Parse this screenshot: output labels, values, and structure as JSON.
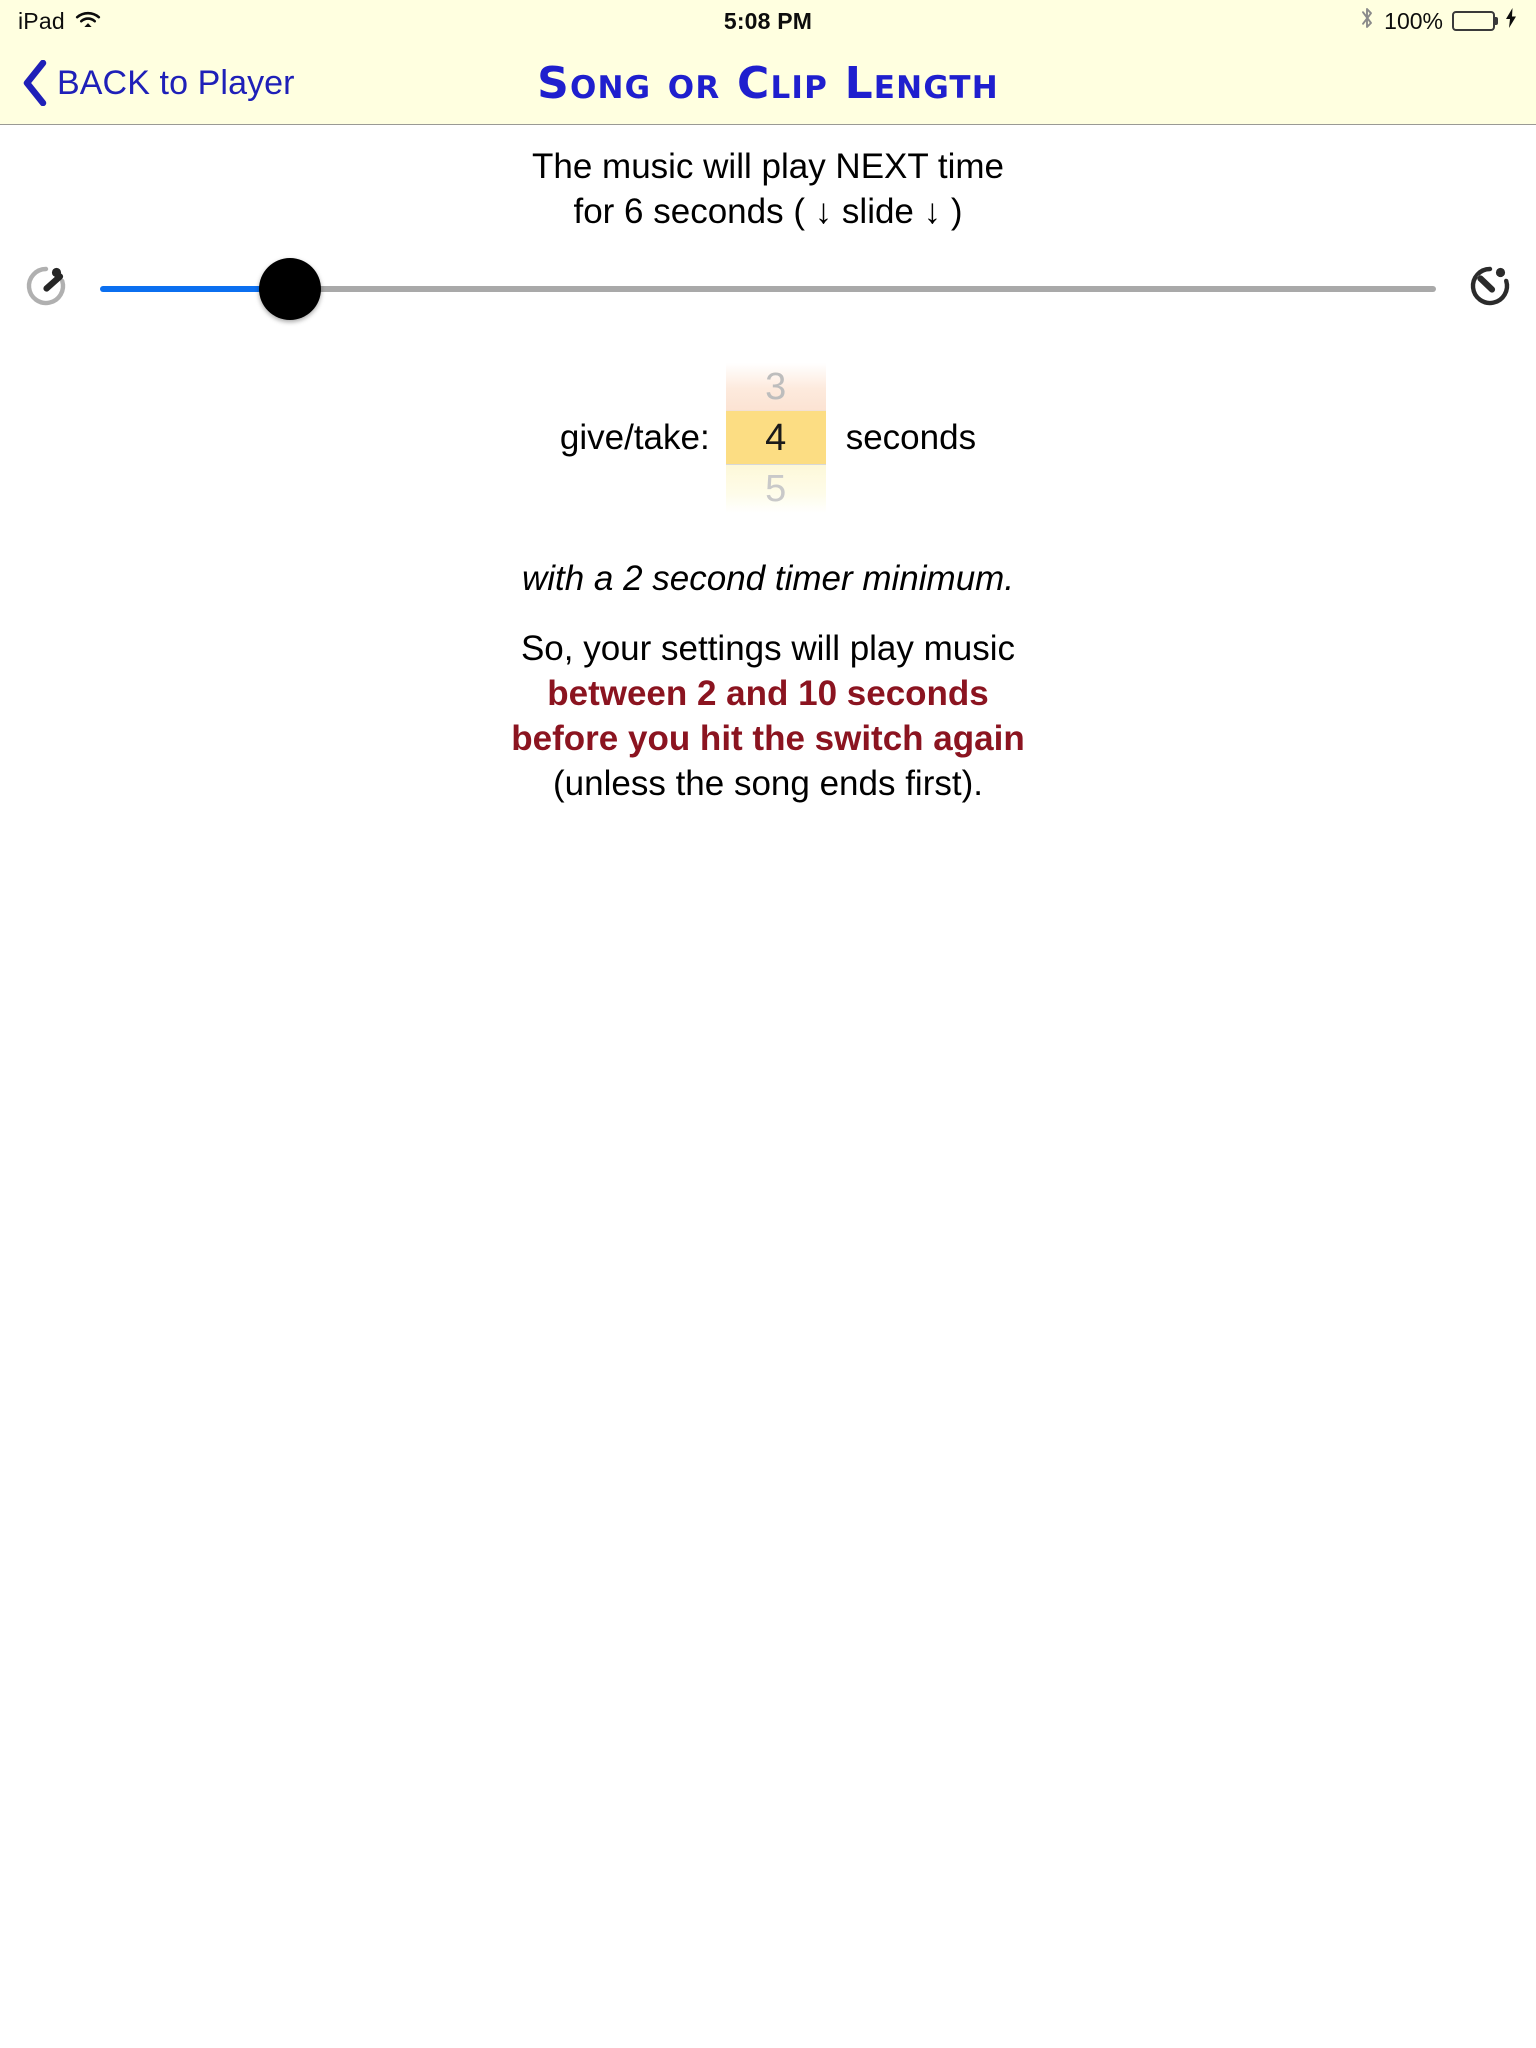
{
  "status_bar": {
    "device": "iPad",
    "wifi_icon": "wifi-icon",
    "time": "5:08 PM",
    "bluetooth_icon": "bluetooth-icon",
    "battery_percent": "100%",
    "battery_icon": "battery-charging-icon",
    "battery_color": "#4cd964"
  },
  "nav_bar": {
    "back_icon": "chevron-left-icon",
    "back_label": "BACK to Player",
    "title": "Song or Clip Length",
    "title_color": "#1f1fce",
    "background_color": "#ffffe0"
  },
  "intro": {
    "line1": "The music will play NEXT time",
    "line2": "for 6 seconds ( ↓ slide ↓ )"
  },
  "slider": {
    "left_icon": "timer-start-icon",
    "right_icon": "timer-end-icon",
    "value_seconds": 6,
    "percent": 14.2,
    "filled_color": "#0b6ff0",
    "remaining_color": "#a9a9a9",
    "thumb_color": "#000000"
  },
  "give_take": {
    "label": "give/take:",
    "previous_option": "3",
    "selected_option": "4",
    "next_option": "5",
    "unit_label": "seconds",
    "selected_color": "#fcdd83"
  },
  "outro": {
    "minimum_note": "with a 2 second timer minimum.",
    "so_line": "So, your settings will play music",
    "emphasis_line1": "between 2 and 10 seconds",
    "emphasis_line2": "before you hit the switch again",
    "unless_line": "(unless the song ends first).",
    "emphasis_color": "#8b1420"
  }
}
